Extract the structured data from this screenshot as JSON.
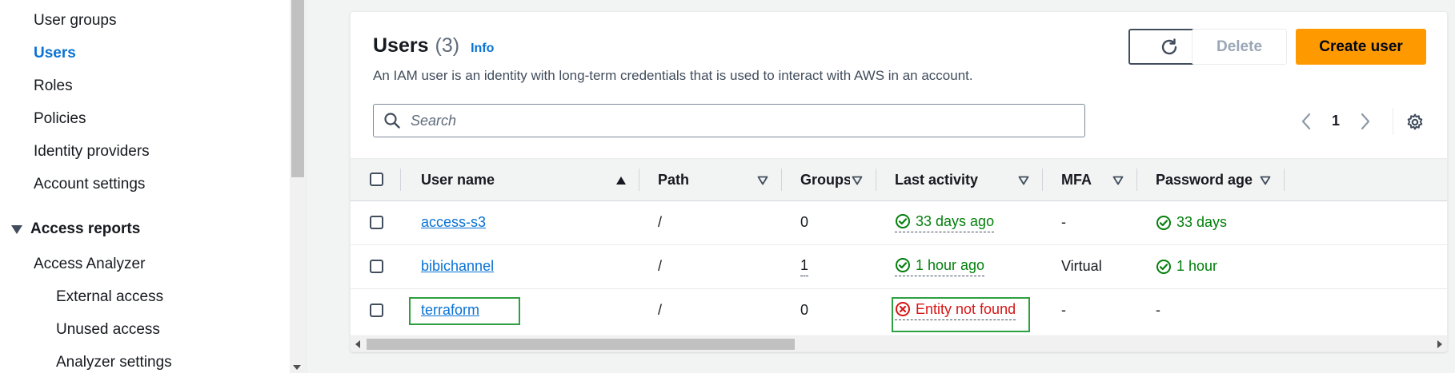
{
  "sidebar": {
    "items": [
      {
        "label": "User groups"
      },
      {
        "label": "Users"
      },
      {
        "label": "Roles"
      },
      {
        "label": "Policies"
      },
      {
        "label": "Identity providers"
      },
      {
        "label": "Account settings"
      }
    ],
    "section": {
      "label": "Access reports",
      "expanded": true
    },
    "reports": [
      {
        "label": "Access Analyzer"
      },
      {
        "label": "External access"
      },
      {
        "label": "Unused access"
      },
      {
        "label": "Analyzer settings"
      }
    ],
    "active_item": "Users"
  },
  "panel": {
    "title": "Users",
    "count": "(3)",
    "info_link": "Info",
    "description": "An IAM user is an identity with long-term credentials that is used to interact with AWS in an account."
  },
  "actions": {
    "refresh_icon": "refresh-icon",
    "delete_label": "Delete",
    "create_label": "Create user"
  },
  "search": {
    "placeholder": "Search",
    "value": ""
  },
  "pagination": {
    "current_page": "1"
  },
  "table": {
    "columns": [
      {
        "label": "User name",
        "sort": "ascending"
      },
      {
        "label": "Path"
      },
      {
        "label": "Groups"
      },
      {
        "label": "Last activity"
      },
      {
        "label": "MFA"
      },
      {
        "label": "Password age"
      }
    ],
    "rows": [
      {
        "user_name": "access-s3",
        "path": "/",
        "groups": "0",
        "last_activity": "33 days ago",
        "activity_status": "ok",
        "mfa": "-",
        "password_age": "33 days",
        "password_status": "ok"
      },
      {
        "user_name": "bibichannel",
        "path": "/",
        "groups": "1",
        "last_activity": "1 hour ago",
        "activity_status": "ok",
        "mfa": "Virtual",
        "password_age": "1 hour",
        "password_status": "ok"
      },
      {
        "user_name": "terraform",
        "path": "/",
        "groups": "0",
        "last_activity": "Entity not found",
        "activity_status": "error",
        "mfa": "-",
        "password_age": "-",
        "password_status": "none"
      }
    ]
  },
  "colors": {
    "link": "#0972d3",
    "success": "#037f0c",
    "error": "#d91515",
    "primary_button": "#ff9900",
    "highlight_box": "#2ea043"
  }
}
